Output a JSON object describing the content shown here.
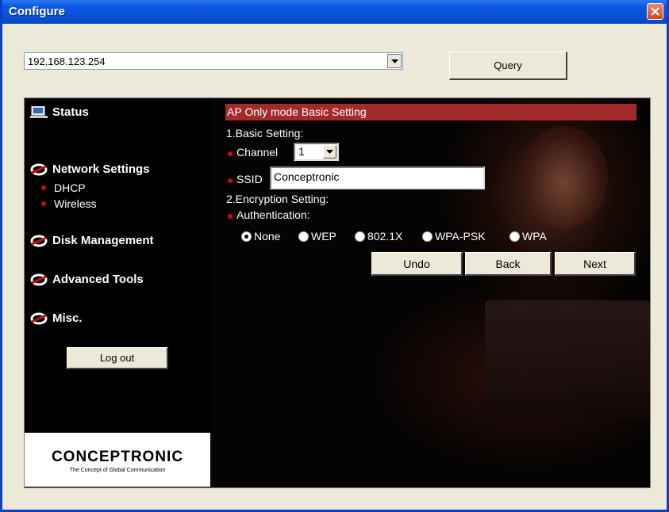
{
  "window": {
    "title": "Configure"
  },
  "toolbar": {
    "address_value": "192.168.123.254",
    "query_label": "Query"
  },
  "sidebar": {
    "items": [
      {
        "label": "Status",
        "icon": "monitor-icon"
      },
      {
        "label": "Network Settings",
        "icon": "ring-icon"
      },
      {
        "label": "Disk Management",
        "icon": "ring-icon"
      },
      {
        "label": "Advanced Tools",
        "icon": "ring-icon"
      },
      {
        "label": "Misc.",
        "icon": "ring-icon"
      }
    ],
    "subitems": [
      "DHCP",
      "Wireless"
    ],
    "logout_label": "Log out"
  },
  "logo": {
    "name": "CONCEPTRONIC",
    "tagline": "The Concept of Global Communication"
  },
  "main": {
    "section_title": "AP Only mode Basic Setting",
    "basic_heading": "1.Basic Setting:",
    "channel_label": "Channel",
    "channel_value": "1",
    "ssid_label": "SSID",
    "ssid_value": "Conceptronic",
    "enc_heading": "2.Encryption Setting:",
    "auth_label": "Authentication:",
    "auth_options": [
      "None",
      "WEP",
      "802.1X",
      "WPA-PSK",
      "WPA"
    ],
    "auth_selected": "None",
    "buttons": {
      "undo": "Undo",
      "back": "Back",
      "next": "Next"
    }
  },
  "colors": {
    "titlebar": "#0852d8",
    "section_bar": "#a32a2a",
    "bullet": "#c41010"
  }
}
